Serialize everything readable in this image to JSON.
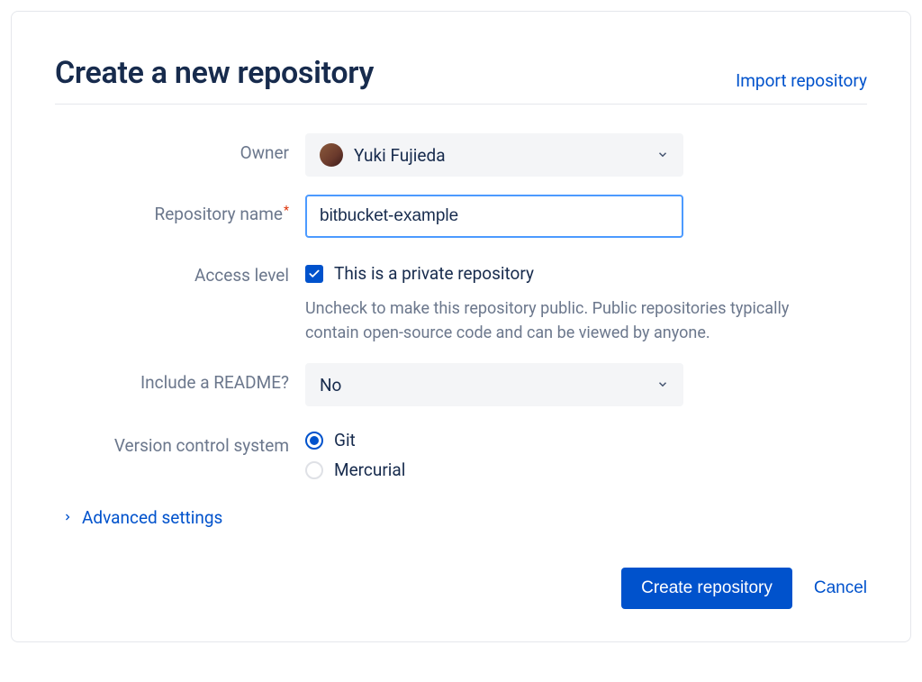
{
  "header": {
    "title": "Create a new repository",
    "import_link": "Import repository"
  },
  "form": {
    "owner": {
      "label": "Owner",
      "value": "Yuki Fujieda"
    },
    "repo_name": {
      "label": "Repository name",
      "value": "bitbucket-example"
    },
    "access": {
      "label": "Access level",
      "checkbox_label": "This is a private repository",
      "help": "Uncheck to make this repository public. Public repositories typically contain open-source code and can be viewed by anyone."
    },
    "readme": {
      "label": "Include a README?",
      "value": "No"
    },
    "vcs": {
      "label": "Version control system",
      "options": [
        "Git",
        "Mercurial"
      ],
      "selected": "Git"
    },
    "advanced_label": "Advanced settings"
  },
  "footer": {
    "submit": "Create repository",
    "cancel": "Cancel"
  }
}
